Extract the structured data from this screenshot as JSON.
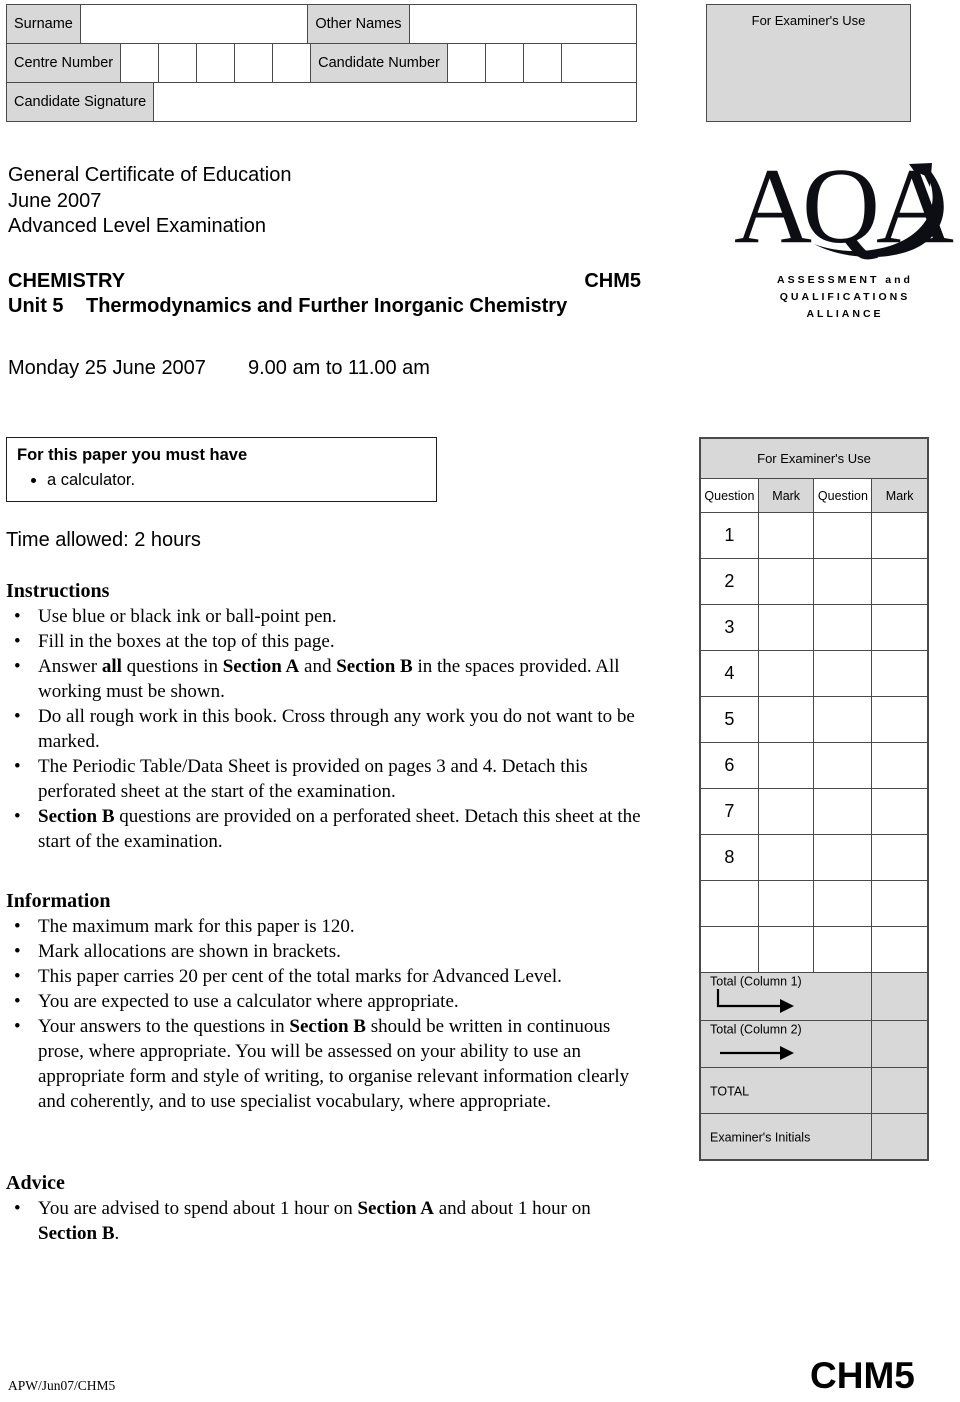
{
  "candidate_grid": {
    "surname_label": "Surname",
    "other_names_label": "Other Names",
    "centre_number_label": "Centre Number",
    "candidate_number_label": "Candidate Number",
    "candidate_signature_label": "Candidate Signature",
    "centre_number_boxes": 5,
    "candidate_number_boxes": 4
  },
  "examiner_top_box": {
    "title": "For Examiner's Use"
  },
  "heading": {
    "line1": "General Certificate of Education",
    "line2": "June 2007",
    "line3": "Advanced Level Examination",
    "subject": "CHEMISTRY",
    "paper_code": "CHM5",
    "unit_number": "Unit 5",
    "unit_title": "Thermodynamics and Further Inorganic Chemistry",
    "exam_date": "Monday 25 June 2007",
    "exam_time": "9.00 am to 11.00 am"
  },
  "logo": {
    "wordmark": "AQA",
    "sub_line1": "ASSESSMENT and",
    "sub_line2": "QUALIFICATIONS",
    "sub_line3": "ALLIANCE"
  },
  "must_have": {
    "title": "For this paper you must have",
    "items": [
      "a calculator."
    ]
  },
  "time_allowed": "Time allowed: 2 hours",
  "instructions": {
    "heading": "Instructions",
    "items": [
      {
        "text": "Use blue or black ink or ball-point pen."
      },
      {
        "text": "Fill in the boxes at the top of this page."
      },
      {
        "text": "Answer all questions in Section A and Section B in the spaces provided. All working must be shown.",
        "bold_parts": [
          "all",
          "Section A",
          "Section B"
        ]
      },
      {
        "text": "Do all rough work in this book.  Cross through any work you do not want to be marked."
      },
      {
        "text": "The Periodic Table/Data Sheet is provided on pages 3 and 4.  Detach this perforated sheet at the start of the examination."
      },
      {
        "text": "Section B questions are provided on a perforated sheet.  Detach this sheet at the start of the examination.",
        "bold_parts": [
          "Section B"
        ]
      }
    ]
  },
  "information": {
    "heading": "Information",
    "items": [
      {
        "text": "The maximum mark for this paper is 120."
      },
      {
        "text": "Mark allocations are shown in brackets."
      },
      {
        "text": "This paper carries 20 per cent of the total marks for Advanced Level."
      },
      {
        "text": "You are expected to use a calculator where appropriate."
      },
      {
        "text": "Your answers to the questions in Section B should be written in continuous prose, where appropriate.  You will be assessed on your ability to use an appropriate form and style of writing, to organise relevant information clearly and coherently, and to use specialist vocabulary, where appropriate.",
        "bold_parts": [
          "Section B"
        ]
      }
    ]
  },
  "advice": {
    "heading": "Advice",
    "items": [
      {
        "text": "You are advised to spend about 1 hour on Section A and about 1 hour on Section B.",
        "bold_parts": [
          "Section A",
          "Section B"
        ]
      }
    ]
  },
  "mark_table": {
    "title": "For Examiner's Use",
    "headers": [
      "Question",
      "Mark",
      "Question",
      "Mark"
    ],
    "rows": [
      {
        "q1": "1",
        "m1": "",
        "q2": "",
        "m2": ""
      },
      {
        "q1": "2",
        "m1": "",
        "q2": "",
        "m2": ""
      },
      {
        "q1": "3",
        "m1": "",
        "q2": "",
        "m2": ""
      },
      {
        "q1": "4",
        "m1": "",
        "q2": "",
        "m2": ""
      },
      {
        "q1": "5",
        "m1": "",
        "q2": "",
        "m2": ""
      },
      {
        "q1": "6",
        "m1": "",
        "q2": "",
        "m2": ""
      },
      {
        "q1": "7",
        "m1": "",
        "q2": "",
        "m2": ""
      },
      {
        "q1": "8",
        "m1": "",
        "q2": "",
        "m2": ""
      },
      {
        "q1": "",
        "m1": "",
        "q2": "",
        "m2": ""
      },
      {
        "q1": "",
        "m1": "",
        "q2": "",
        "m2": ""
      }
    ],
    "total_col1_label": "Total (Column 1)",
    "total_col2_label": "Total (Column 2)",
    "total_label": "TOTAL",
    "initials_label": "Examiner's Initials"
  },
  "footer": {
    "code": "APW/Jun07/CHM5",
    "paper": "CHM5"
  },
  "colors": {
    "shade": "#d8d8d8",
    "rule": "#4a4a4a",
    "text": "#000000"
  }
}
